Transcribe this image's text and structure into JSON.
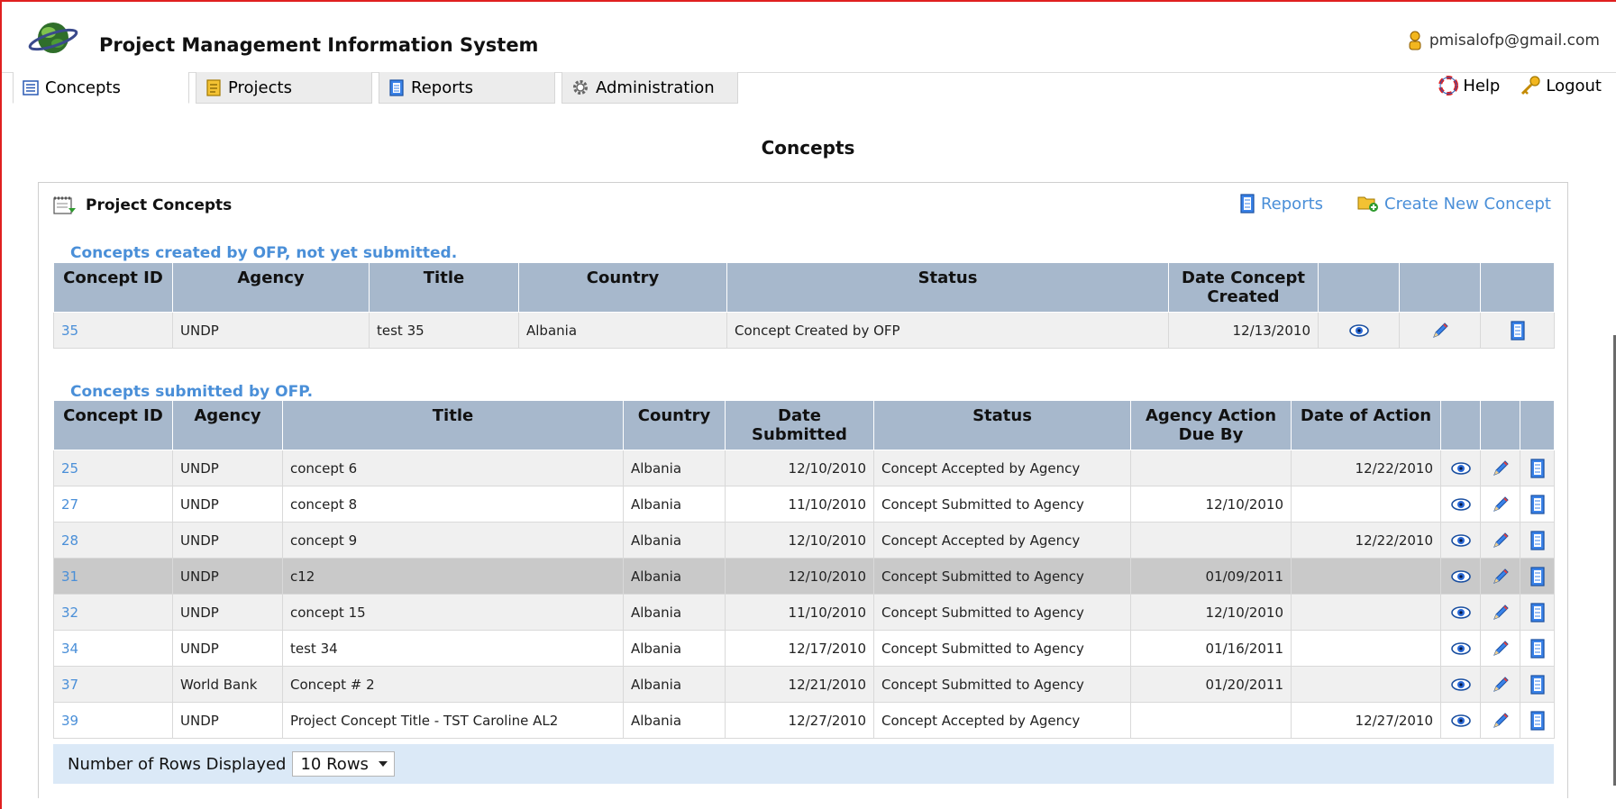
{
  "header": {
    "title": "Project Management Information System",
    "user_email": "pmisalofp@gmail.com"
  },
  "tabs": [
    {
      "label": "Concepts",
      "icon": "list-icon",
      "active": true
    },
    {
      "label": "Projects",
      "icon": "projects-icon",
      "active": false
    },
    {
      "label": "Reports",
      "icon": "reports-icon",
      "active": false
    },
    {
      "label": "Administration",
      "icon": "gear-icon",
      "active": false
    }
  ],
  "top_links": {
    "help": "Help",
    "logout": "Logout"
  },
  "page_title": "Concepts",
  "panel": {
    "title": "Project Concepts",
    "reports_link": "Reports",
    "create_link": "Create New Concept"
  },
  "not_submitted": {
    "title": "Concepts created by OFP, not yet submitted.",
    "headers": [
      "Concept ID",
      "Agency",
      "Title",
      "Country",
      "Status",
      "Date Concept Created",
      "",
      "",
      ""
    ],
    "rows": [
      {
        "id": "35",
        "agency": "UNDP",
        "title": "test 35",
        "country": "Albania",
        "status": "Concept Created by OFP",
        "created": "12/13/2010"
      }
    ]
  },
  "submitted": {
    "title": "Concepts submitted by OFP.",
    "headers": [
      "Concept ID",
      "Agency",
      "Title",
      "Country",
      "Date Submitted",
      "Status",
      "Agency Action Due By",
      "Date of Action",
      "",
      "",
      ""
    ],
    "rows": [
      {
        "id": "25",
        "agency": "UNDP",
        "title": "concept 6",
        "country": "Albania",
        "submitted": "12/10/2010",
        "status": "Concept Accepted by Agency",
        "due": "",
        "action": "12/22/2010"
      },
      {
        "id": "27",
        "agency": "UNDP",
        "title": "concept 8",
        "country": "Albania",
        "submitted": "11/10/2010",
        "status": "Concept Submitted to Agency",
        "due": "12/10/2010",
        "action": ""
      },
      {
        "id": "28",
        "agency": "UNDP",
        "title": "concept 9",
        "country": "Albania",
        "submitted": "12/10/2010",
        "status": "Concept Accepted by Agency",
        "due": "",
        "action": "12/22/2010"
      },
      {
        "id": "31",
        "agency": "UNDP",
        "title": "c12",
        "country": "Albania",
        "submitted": "12/10/2010",
        "status": "Concept Submitted to Agency",
        "due": "01/09/2011",
        "action": ""
      },
      {
        "id": "32",
        "agency": "UNDP",
        "title": "concept 15",
        "country": "Albania",
        "submitted": "11/10/2010",
        "status": "Concept Submitted to Agency",
        "due": "12/10/2010",
        "action": ""
      },
      {
        "id": "34",
        "agency": "UNDP",
        "title": "test 34",
        "country": "Albania",
        "submitted": "12/17/2010",
        "status": "Concept Submitted to Agency",
        "due": "01/16/2011",
        "action": ""
      },
      {
        "id": "37",
        "agency": "World Bank",
        "title": "Concept # 2",
        "country": "Albania",
        "submitted": "12/21/2010",
        "status": "Concept Submitted to Agency",
        "due": "01/20/2011",
        "action": ""
      },
      {
        "id": "39",
        "agency": "UNDP",
        "title": "Project Concept Title - TST Caroline AL2",
        "country": "Albania",
        "submitted": "12/27/2010",
        "status": "Concept Accepted by Agency",
        "due": "",
        "action": "12/27/2010"
      }
    ]
  },
  "footer": {
    "rows_label": "Number of Rows Displayed",
    "rows_value": "10 Rows"
  },
  "colors": {
    "link": "#4a8fd8",
    "header_bg": "#a7b8cc",
    "footer_bg": "#dbe9f7",
    "frame": "#e02020"
  }
}
